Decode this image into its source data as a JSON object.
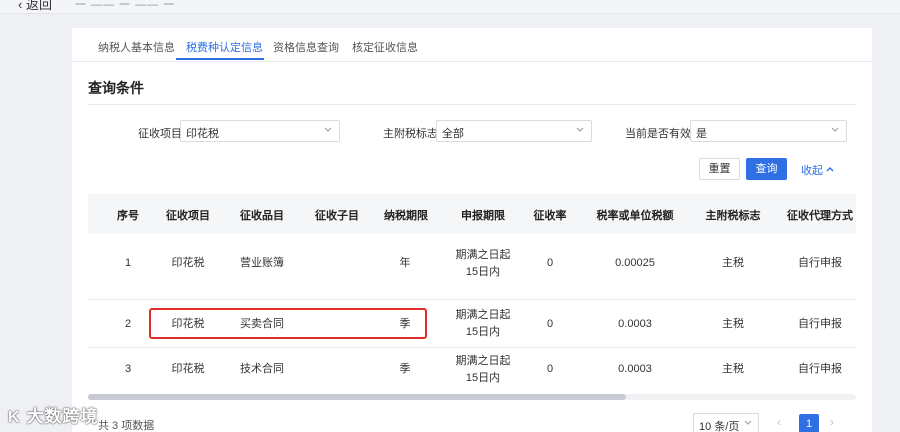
{
  "topbar": {
    "back_label": "返回",
    "breadcrumb": "一 —— 一 —— 一"
  },
  "tabs": [
    {
      "label": "纳税人基本信息",
      "active": false
    },
    {
      "label": "税费种认定信息",
      "active": true
    },
    {
      "label": "资格信息查询",
      "active": false
    },
    {
      "label": "核定征收信息",
      "active": false
    }
  ],
  "section_title": "查询条件",
  "filters": {
    "levy_item": {
      "label": "征收项目",
      "value": "印花税"
    },
    "main_sub_flag": {
      "label": "主附税标志",
      "value": "全部"
    },
    "currently_valid": {
      "label": "当前是否有效",
      "value": "是"
    }
  },
  "buttons": {
    "reset": "重置",
    "query": "查询",
    "collapse": "收起"
  },
  "table": {
    "columns": [
      "序号",
      "征收项目",
      "征收品目",
      "征收子目",
      "纳税期限",
      "申报期限",
      "征收率",
      "税率或单位税额",
      "主附税标志",
      "征收代理方式"
    ],
    "rows": [
      {
        "no": "1",
        "item": "印花税",
        "category": "营业账簿",
        "sub": "",
        "period": "年",
        "deadline_1": "期满之日起",
        "deadline_2": "15日内",
        "rate": "0",
        "tax": "0.00025",
        "flag": "主税",
        "agent": "自行申报"
      },
      {
        "no": "2",
        "item": "印花税",
        "category": "买卖合同",
        "sub": "",
        "period": "季",
        "deadline_1": "期满之日起",
        "deadline_2": "15日内",
        "rate": "0",
        "tax": "0.0003",
        "flag": "主税",
        "agent": "自行申报"
      },
      {
        "no": "3",
        "item": "印花税",
        "category": "技术合同",
        "sub": "",
        "period": "季",
        "deadline_1": "期满之日起",
        "deadline_2": "15日内",
        "rate": "0",
        "tax": "0.0003",
        "flag": "主税",
        "agent": "自行申报"
      }
    ]
  },
  "pagination": {
    "total_text": "共 3 项数据",
    "page_size": "10 条/页",
    "current_page": "1"
  },
  "watermark": {
    "logo": "K",
    "text": "大数跨境"
  },
  "colors": {
    "accent": "#2f6fe4",
    "highlight": "#e02b2b"
  }
}
